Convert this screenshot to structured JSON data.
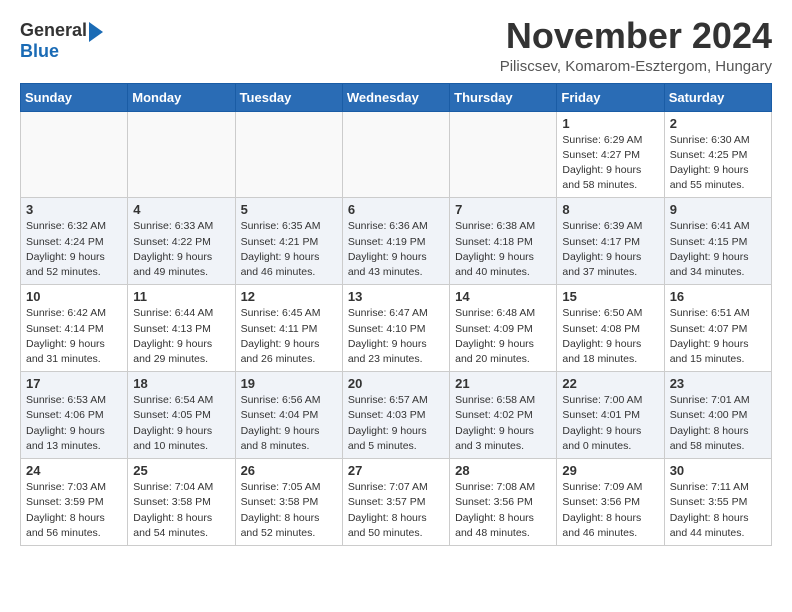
{
  "header": {
    "logo_general": "General",
    "logo_blue": "Blue",
    "title": "November 2024",
    "location": "Piliscsev, Komarom-Esztergom, Hungary"
  },
  "weekdays": [
    "Sunday",
    "Monday",
    "Tuesday",
    "Wednesday",
    "Thursday",
    "Friday",
    "Saturday"
  ],
  "weeks": [
    [
      {
        "day": "",
        "info": ""
      },
      {
        "day": "",
        "info": ""
      },
      {
        "day": "",
        "info": ""
      },
      {
        "day": "",
        "info": ""
      },
      {
        "day": "",
        "info": ""
      },
      {
        "day": "1",
        "info": "Sunrise: 6:29 AM\nSunset: 4:27 PM\nDaylight: 9 hours\nand 58 minutes."
      },
      {
        "day": "2",
        "info": "Sunrise: 6:30 AM\nSunset: 4:25 PM\nDaylight: 9 hours\nand 55 minutes."
      }
    ],
    [
      {
        "day": "3",
        "info": "Sunrise: 6:32 AM\nSunset: 4:24 PM\nDaylight: 9 hours\nand 52 minutes."
      },
      {
        "day": "4",
        "info": "Sunrise: 6:33 AM\nSunset: 4:22 PM\nDaylight: 9 hours\nand 49 minutes."
      },
      {
        "day": "5",
        "info": "Sunrise: 6:35 AM\nSunset: 4:21 PM\nDaylight: 9 hours\nand 46 minutes."
      },
      {
        "day": "6",
        "info": "Sunrise: 6:36 AM\nSunset: 4:19 PM\nDaylight: 9 hours\nand 43 minutes."
      },
      {
        "day": "7",
        "info": "Sunrise: 6:38 AM\nSunset: 4:18 PM\nDaylight: 9 hours\nand 40 minutes."
      },
      {
        "day": "8",
        "info": "Sunrise: 6:39 AM\nSunset: 4:17 PM\nDaylight: 9 hours\nand 37 minutes."
      },
      {
        "day": "9",
        "info": "Sunrise: 6:41 AM\nSunset: 4:15 PM\nDaylight: 9 hours\nand 34 minutes."
      }
    ],
    [
      {
        "day": "10",
        "info": "Sunrise: 6:42 AM\nSunset: 4:14 PM\nDaylight: 9 hours\nand 31 minutes."
      },
      {
        "day": "11",
        "info": "Sunrise: 6:44 AM\nSunset: 4:13 PM\nDaylight: 9 hours\nand 29 minutes."
      },
      {
        "day": "12",
        "info": "Sunrise: 6:45 AM\nSunset: 4:11 PM\nDaylight: 9 hours\nand 26 minutes."
      },
      {
        "day": "13",
        "info": "Sunrise: 6:47 AM\nSunset: 4:10 PM\nDaylight: 9 hours\nand 23 minutes."
      },
      {
        "day": "14",
        "info": "Sunrise: 6:48 AM\nSunset: 4:09 PM\nDaylight: 9 hours\nand 20 minutes."
      },
      {
        "day": "15",
        "info": "Sunrise: 6:50 AM\nSunset: 4:08 PM\nDaylight: 9 hours\nand 18 minutes."
      },
      {
        "day": "16",
        "info": "Sunrise: 6:51 AM\nSunset: 4:07 PM\nDaylight: 9 hours\nand 15 minutes."
      }
    ],
    [
      {
        "day": "17",
        "info": "Sunrise: 6:53 AM\nSunset: 4:06 PM\nDaylight: 9 hours\nand 13 minutes."
      },
      {
        "day": "18",
        "info": "Sunrise: 6:54 AM\nSunset: 4:05 PM\nDaylight: 9 hours\nand 10 minutes."
      },
      {
        "day": "19",
        "info": "Sunrise: 6:56 AM\nSunset: 4:04 PM\nDaylight: 9 hours\nand 8 minutes."
      },
      {
        "day": "20",
        "info": "Sunrise: 6:57 AM\nSunset: 4:03 PM\nDaylight: 9 hours\nand 5 minutes."
      },
      {
        "day": "21",
        "info": "Sunrise: 6:58 AM\nSunset: 4:02 PM\nDaylight: 9 hours\nand 3 minutes."
      },
      {
        "day": "22",
        "info": "Sunrise: 7:00 AM\nSunset: 4:01 PM\nDaylight: 9 hours\nand 0 minutes."
      },
      {
        "day": "23",
        "info": "Sunrise: 7:01 AM\nSunset: 4:00 PM\nDaylight: 8 hours\nand 58 minutes."
      }
    ],
    [
      {
        "day": "24",
        "info": "Sunrise: 7:03 AM\nSunset: 3:59 PM\nDaylight: 8 hours\nand 56 minutes."
      },
      {
        "day": "25",
        "info": "Sunrise: 7:04 AM\nSunset: 3:58 PM\nDaylight: 8 hours\nand 54 minutes."
      },
      {
        "day": "26",
        "info": "Sunrise: 7:05 AM\nSunset: 3:58 PM\nDaylight: 8 hours\nand 52 minutes."
      },
      {
        "day": "27",
        "info": "Sunrise: 7:07 AM\nSunset: 3:57 PM\nDaylight: 8 hours\nand 50 minutes."
      },
      {
        "day": "28",
        "info": "Sunrise: 7:08 AM\nSunset: 3:56 PM\nDaylight: 8 hours\nand 48 minutes."
      },
      {
        "day": "29",
        "info": "Sunrise: 7:09 AM\nSunset: 3:56 PM\nDaylight: 8 hours\nand 46 minutes."
      },
      {
        "day": "30",
        "info": "Sunrise: 7:11 AM\nSunset: 3:55 PM\nDaylight: 8 hours\nand 44 minutes."
      }
    ]
  ]
}
